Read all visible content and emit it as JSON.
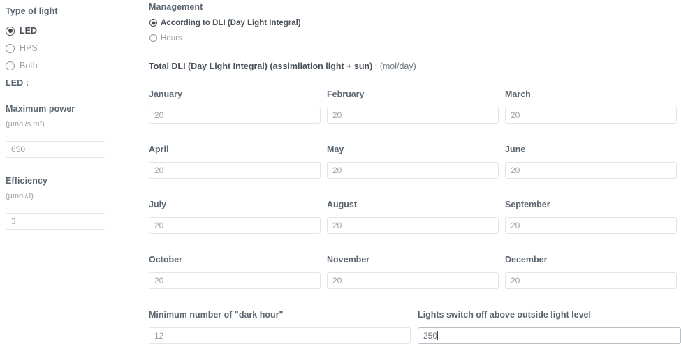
{
  "sidebar": {
    "type_of_light_title": "Type of light",
    "light_types": [
      {
        "label": "LED",
        "selected": true
      },
      {
        "label": "HPS",
        "selected": false
      },
      {
        "label": "Both",
        "selected": false
      }
    ],
    "selected_section_title": "LED :",
    "max_power": {
      "label": "Maximum power",
      "unit": "(µmol/s m²)",
      "value": "650"
    },
    "efficiency": {
      "label": "Efficiency",
      "unit": "(µmol/J)",
      "value": "3"
    }
  },
  "main": {
    "management": {
      "title": "Management",
      "options": [
        {
          "label": "According to DLI (Day Light Integral)",
          "selected": true
        },
        {
          "label": "Hours",
          "selected": false
        }
      ]
    },
    "dli_heading": {
      "bold": "Total DLI (Day Light Integral) (assimilation light + sun)",
      "rest": " : (mol/day)"
    },
    "months": [
      {
        "label": "January",
        "value": "20"
      },
      {
        "label": "February",
        "value": "20"
      },
      {
        "label": "March",
        "value": "20"
      },
      {
        "label": "April",
        "value": "20"
      },
      {
        "label": "May",
        "value": "20"
      },
      {
        "label": "June",
        "value": "20"
      },
      {
        "label": "July",
        "value": "20"
      },
      {
        "label": "August",
        "value": "20"
      },
      {
        "label": "September",
        "value": "20"
      },
      {
        "label": "October",
        "value": "20"
      },
      {
        "label": "November",
        "value": "20"
      },
      {
        "label": "December",
        "value": "20"
      }
    ],
    "dark_hour": {
      "label": "Minimum number of \"dark hour\"",
      "value": "12"
    },
    "switch_off": {
      "label": "Lights switch off above outside light level",
      "value": "250",
      "focused": true
    }
  },
  "colors": {
    "label": "#5c6670",
    "muted": "#9aa1a8",
    "border": "#e2e4e7",
    "border_focus": "#b9bfc5",
    "background": "#ffffff"
  }
}
